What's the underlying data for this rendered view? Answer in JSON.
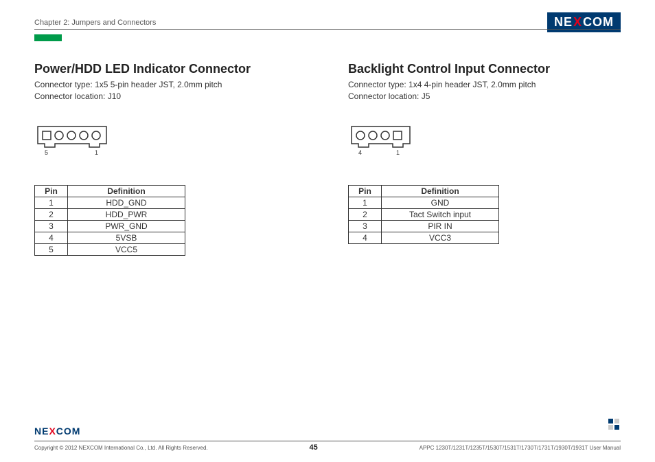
{
  "header": {
    "chapter": "Chapter 2: Jumpers and Connectors",
    "logo_pre": "NE",
    "logo_mid": "X",
    "logo_post": "COM"
  },
  "left": {
    "title": "Power/HDD LED Indicator Connector",
    "desc1": "Connector type: 1x5 5-pin header JST, 2.0mm pitch",
    "desc2": "Connector location: J10",
    "pin_label_right": "1",
    "pin_label_left": "5",
    "th_pin": "Pin",
    "th_def": "Definition",
    "rows": [
      {
        "pin": "1",
        "def": "HDD_GND"
      },
      {
        "pin": "2",
        "def": "HDD_PWR"
      },
      {
        "pin": "3",
        "def": "PWR_GND"
      },
      {
        "pin": "4",
        "def": "5VSB"
      },
      {
        "pin": "5",
        "def": "VCC5"
      }
    ]
  },
  "right": {
    "title": "Backlight Control Input Connector",
    "desc1": "Connector type: 1x4 4-pin header JST, 2.0mm pitch",
    "desc2": "Connector location: J5",
    "pin_label_right": "1",
    "pin_label_left": "4",
    "th_pin": "Pin",
    "th_def": "Definition",
    "rows": [
      {
        "pin": "1",
        "def": "GND"
      },
      {
        "pin": "2",
        "def": "Tact Switch input"
      },
      {
        "pin": "3",
        "def": "PIR IN"
      },
      {
        "pin": "4",
        "def": "VCC3"
      }
    ]
  },
  "footer": {
    "logo_pre": "NE",
    "logo_mid": "X",
    "logo_post": "COM",
    "copyright": "Copyright © 2012 NEXCOM International Co., Ltd. All Rights Reserved.",
    "page": "45",
    "manual": "APPC 1230T/1231T/1235T/1530T/1531T/1730T/1731T/1930T/1931T User Manual"
  }
}
